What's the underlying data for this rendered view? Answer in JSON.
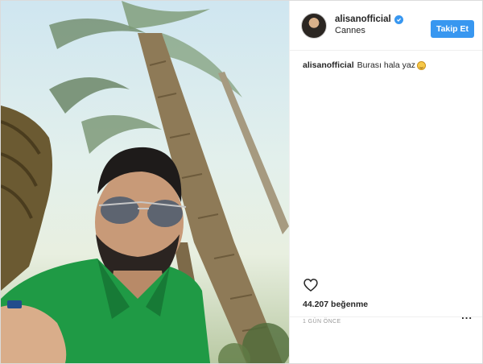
{
  "header": {
    "username": "alisanofficial",
    "location": "Cannes",
    "follow_label": "Takip Et"
  },
  "caption": {
    "username": "alisanofficial",
    "text": "Burası hala yaz"
  },
  "footer": {
    "likes": "44.207 beğenme",
    "time": "1 GÜN ÖNCE",
    "more": "..."
  },
  "icons": {
    "verified": "verified-badge-icon",
    "like": "heart-icon",
    "emoji": "smiling-face-emoji-icon",
    "more": "more-options-icon"
  },
  "colors": {
    "accent": "#3897f0",
    "text": "#262626",
    "muted": "#999999",
    "shirt": "#1f9a45"
  }
}
